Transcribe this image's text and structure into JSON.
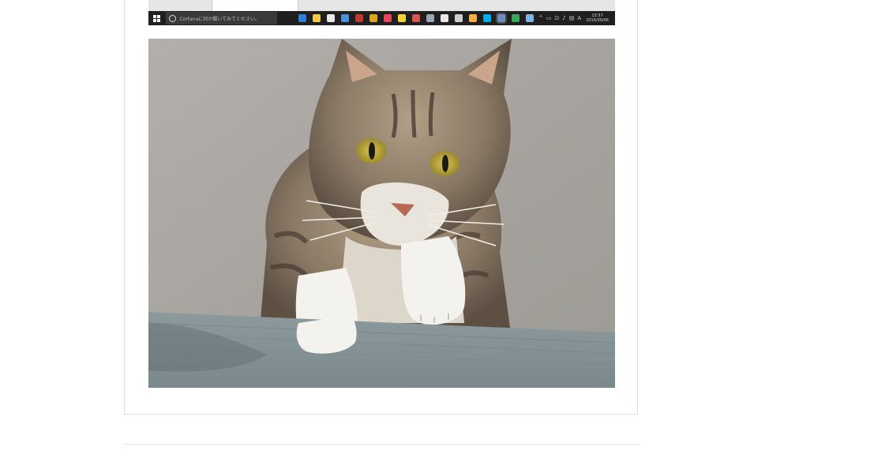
{
  "taskbar": {
    "start_icon": "windows-logo-icon",
    "search_placeholder": "Cortanaに何か聞いてみてください。",
    "pinned_icons": [
      {
        "name": "task-view-icon",
        "color": "#1f1f1f",
        "active": false
      },
      {
        "name": "edge-icon",
        "color": "#2f7fd8",
        "active": false
      },
      {
        "name": "file-explorer-icon",
        "color": "#f2c94c",
        "active": false
      },
      {
        "name": "store-icon",
        "color": "#e8e8e8",
        "active": false
      },
      {
        "name": "photos-icon",
        "color": "#4a90d9",
        "active": false
      },
      {
        "name": "game-icon",
        "color": "#c0392b",
        "active": false
      },
      {
        "name": "chrome-icon",
        "color": "#e0a422",
        "active": false
      },
      {
        "name": "app-red-icon",
        "color": "#e54856",
        "active": false
      },
      {
        "name": "notes-icon",
        "color": "#f4d23c",
        "active": false
      },
      {
        "name": "app-stripe-icon",
        "color": "#d9534f",
        "active": false
      },
      {
        "name": "network-icon",
        "color": "#9aa6b2",
        "active": false
      },
      {
        "name": "app-circle-icon",
        "color": "#e8e8e8",
        "active": false
      },
      {
        "name": "gear-icon",
        "color": "#cfcfcf",
        "active": false
      },
      {
        "name": "paint-icon",
        "color": "#f5b041",
        "active": false
      },
      {
        "name": "skype-icon",
        "color": "#00aff0",
        "active": false
      },
      {
        "name": "browser-active-icon",
        "color": "#6c8ebf",
        "active": true
      },
      {
        "name": "app-globe-icon",
        "color": "#3ba55c",
        "active": false
      },
      {
        "name": "app-doc-icon",
        "color": "#7fb2e5",
        "active": false
      }
    ],
    "tray_glyphs": [
      "^",
      "▭",
      "⊡",
      "♪",
      "▤",
      "A"
    ],
    "clock_time": "13:57",
    "clock_date": "2016/09/06"
  },
  "photo": {
    "subject": "tabby-cat-photo"
  }
}
